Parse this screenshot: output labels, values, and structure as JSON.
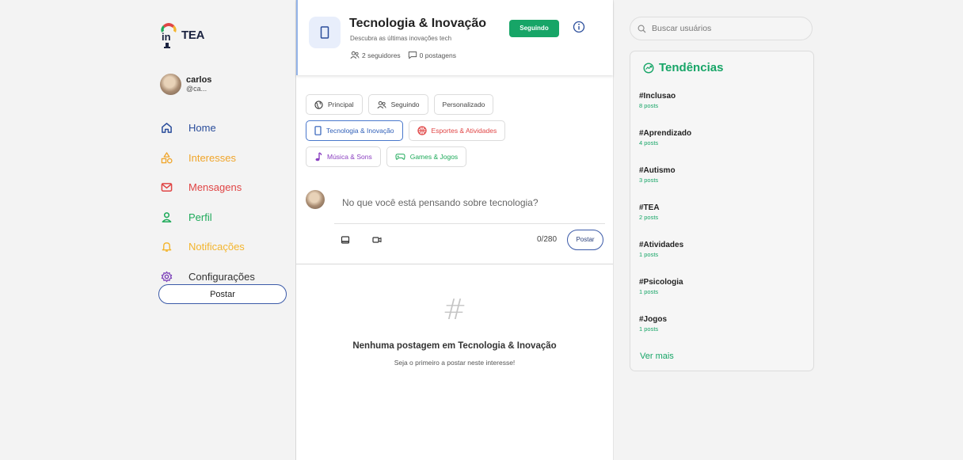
{
  "app": {
    "logo_text": "TEA",
    "logo_prefix": "in"
  },
  "user": {
    "name": "carlos",
    "handle": "@ca..."
  },
  "nav": {
    "items": [
      {
        "label": "Home",
        "icon": "home-icon",
        "color": "#2a4d9b"
      },
      {
        "label": "Interesses",
        "icon": "shapes-icon",
        "color": "#f0a52a"
      },
      {
        "label": "Mensagens",
        "icon": "mail-icon",
        "color": "#e04545"
      },
      {
        "label": "Perfil",
        "icon": "user-icon",
        "color": "#1eaa5a"
      },
      {
        "label": "Notificações",
        "icon": "bell-icon",
        "color": "#f3b52e"
      },
      {
        "label": "Configurações",
        "icon": "gear-icon",
        "color": "#7b3fb8"
      }
    ],
    "post_button": "Postar"
  },
  "header": {
    "title": "Tecnologia & Inovação",
    "description": "Descubra as últimas inovações tech",
    "followers": "2 seguidores",
    "posts": "0 postagens",
    "follow_button": "Seguindo"
  },
  "feed_tabs": [
    {
      "label": "Principal",
      "icon": "globe-icon"
    },
    {
      "label": "Seguindo",
      "icon": "users-icon"
    },
    {
      "label": "Personalizado",
      "icon": ""
    }
  ],
  "interest_chips": [
    {
      "label": "Tecnologia & Inovação",
      "icon": "tablet-icon",
      "active": true
    },
    {
      "label": "Esportes & Atividades",
      "icon": "ball-icon",
      "color": "#e04545"
    },
    {
      "label": "Música & Sons",
      "icon": "music-icon",
      "color": "#8a3fc0"
    },
    {
      "label": "Games & Jogos",
      "icon": "gamepad-icon",
      "color": "#1eaa5a"
    }
  ],
  "composer": {
    "placeholder": "No que você está pensando sobre tecnologia?",
    "counter": "0/280",
    "post_button": "Postar"
  },
  "empty_state": {
    "icon": "#",
    "title": "Nenhuma postagem em Tecnologia & Inovação",
    "subtitle": "Seja o primeiro a postar neste interesse!"
  },
  "search": {
    "placeholder": "Buscar usuários"
  },
  "trends": {
    "title": "Tendências",
    "items": [
      {
        "tag": "#Inclusao",
        "count": "8 posts"
      },
      {
        "tag": "#Aprendizado",
        "count": "4 posts"
      },
      {
        "tag": "#Autismo",
        "count": "3 posts"
      },
      {
        "tag": "#TEA",
        "count": "2 posts"
      },
      {
        "tag": "#Atividades",
        "count": "1 posts"
      },
      {
        "tag": "#Psicologia",
        "count": "1 posts"
      },
      {
        "tag": "#Jogos",
        "count": "1 posts"
      }
    ],
    "see_more": "Ver mais"
  },
  "colors": {
    "accent_green": "#17a567",
    "brand_blue": "#2a4d9b"
  }
}
